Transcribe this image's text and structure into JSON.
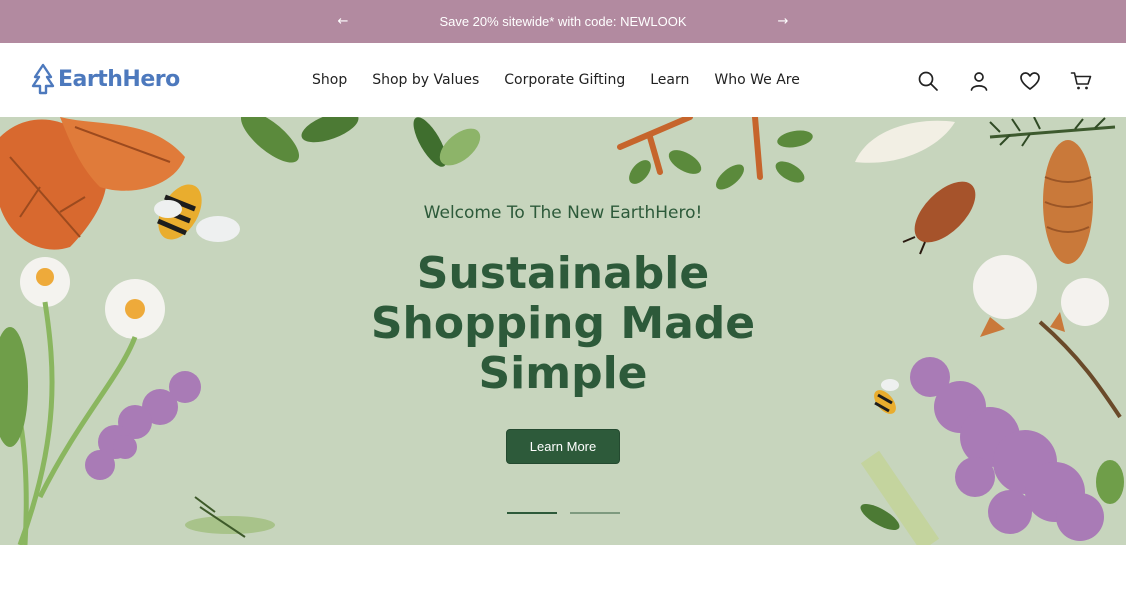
{
  "promo": {
    "text": "Save 20% sitewide* with code: NEWLOOK",
    "prev_arrow": "←",
    "next_arrow": "→"
  },
  "header": {
    "logo_text": "EarthHero",
    "nav": [
      "Shop",
      "Shop by Values",
      "Corporate Gifting",
      "Learn",
      "Who We Are"
    ],
    "icons": [
      "search-icon",
      "account-icon",
      "wishlist-heart-icon",
      "cart-icon"
    ]
  },
  "hero": {
    "eyebrow": "Welcome To The New EarthHero!",
    "title_line1": "Sustainable",
    "title_line2": "Shopping Made",
    "title_line3": "Simple",
    "cta_label": "Learn More",
    "slide_count": 2,
    "active_slide": 1
  },
  "colors": {
    "promo_bg": "#b28aa0",
    "brand_blue": "#4d79bd",
    "hero_bg": "#c7d5bd",
    "hero_green": "#2d5a3a"
  }
}
